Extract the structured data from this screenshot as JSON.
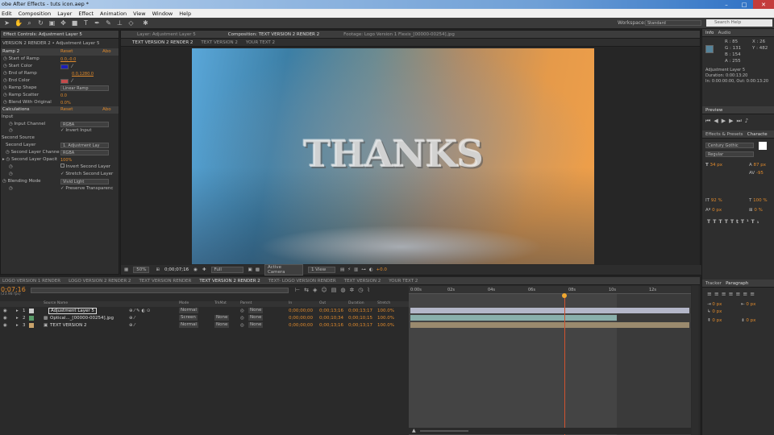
{
  "window": {
    "title": "obe After Effects - tuts icon.aep *"
  },
  "menu": [
    "Edit",
    "Composition",
    "Layer",
    "Effect",
    "Animation",
    "View",
    "Window",
    "Help"
  ],
  "toolbar": {
    "workspace_label": "Workspace:",
    "workspace_value": "Standard",
    "search_placeholder": "Search Help"
  },
  "effect_controls": {
    "tab": "Effect Controls: Adjustment Layer 5",
    "breadcrumb": "VERSION 2 RENDER 2 • Adjustment Layer 5",
    "effect_name": "Ramp 2",
    "reset": "Reset",
    "about": "Abo",
    "rows": [
      {
        "label": "Start of Ramp",
        "value": "0.0,-0.0"
      },
      {
        "label": "Start Color",
        "value": ""
      },
      {
        "label": "End of Ramp",
        "value": "0.0,1280.0"
      },
      {
        "label": "End Color",
        "value": ""
      },
      {
        "label": "Ramp Shape",
        "value": "Linear Ramp"
      },
      {
        "label": "Ramp Scatter",
        "value": "0.0"
      },
      {
        "label": "Blend With Original",
        "value": "0.0%"
      }
    ],
    "calc": {
      "name": "Calculations",
      "reset": "Reset",
      "about": "Abo"
    },
    "input_label": "Input",
    "input_channel": {
      "label": "Input Channel",
      "value": "RGBA"
    },
    "invert_input": "Invert Input",
    "second_source": "Second Source",
    "second_layer": {
      "label": "Second Layer",
      "value": "1. Adjustment Lay"
    },
    "second_layer_channel": {
      "label": "Second Layer Channe",
      "value": "RGBA"
    },
    "second_layer_opacity": {
      "label": "Second Layer Opacit",
      "value": "100%"
    },
    "invert_second": "Invert Second Layer",
    "stretch_second": "Stretch Second Layer",
    "blending_mode": {
      "label": "Blending Mode",
      "value": "Vivid Light"
    },
    "preserve_transparency": "Preserve Transparenc"
  },
  "composition": {
    "tabs": [
      "Layer: Adjustment Layer 5",
      "Composition: TEXT VERSION 2 RENDER 2",
      "Footage: Logo Version 1 Flexis_[00000-00254].jpg"
    ],
    "subtabs": [
      "TEXT VERSION 2 RENDER 2",
      "TEXT VERSION 2",
      "YOUR TEXT 2"
    ],
    "preview_text": "THANKS",
    "viewer_bar": {
      "zoom": "50%",
      "timecode": "0;00;07;16",
      "resolution": "Full",
      "camera": "Active Camera",
      "view": "1 View",
      "offset": "+0.0"
    }
  },
  "timeline": {
    "tabs": [
      "LOGO VERSION 1 RENDER",
      "LOGO VERSION 2 RENDER 2",
      "TEXT VERSION RENDER",
      "TEXT VERSION 2 RENDER 2",
      "TEXT- LOGO VERSION RENDER",
      "TEXT VERSION 2",
      "YOUR TEXT 2"
    ],
    "timecode": "0;07;16",
    "fps": "(23.98 fps)",
    "headers": {
      "source": "Source Name",
      "mode": "Mode",
      "trkmat": "TrkMat",
      "parent": "Parent",
      "in": "In",
      "out": "Out",
      "duration": "Duration",
      "stretch": "Stretch"
    },
    "layers": [
      {
        "num": "1",
        "name": "Adjustment Layer 5",
        "mode": "Normal",
        "trkmat": "",
        "parent": "None",
        "in": "0;00;00;00",
        "out": "0;00;13;16",
        "duration": "0;00;13;17",
        "stretch": "100.0%"
      },
      {
        "num": "2",
        "name": "Optical..._[00000-00254].jpg",
        "mode": "Screen",
        "trkmat": "None",
        "parent": "None",
        "in": "0;00;00;00",
        "out": "0;00;10;34",
        "duration": "0;00;10;15",
        "stretch": "100.0%"
      },
      {
        "num": "3",
        "name": "TEXT VERSION 2",
        "mode": "Normal",
        "trkmat": "None",
        "parent": "None",
        "in": "0;00;00;00",
        "out": "0;00;13;16",
        "duration": "0;00;13;17",
        "stretch": "100.0%"
      }
    ],
    "ruler": [
      "0:00s",
      "02s",
      "04s",
      "06s",
      "08s",
      "10s",
      "12s"
    ],
    "playhead_fraction": 0.55
  },
  "info": {
    "tabs": [
      "Info",
      "Audio"
    ],
    "r": "R : 85",
    "g": "G : 131",
    "b": "B : 154",
    "a": "A : 255",
    "x": "X : 26",
    "y": "Y : 482",
    "layer": "Adjustment Layer 5",
    "duration": "Duration: 0:00:13:20",
    "inout": "In: 0:00:00:00, Out: 0:00:13:20"
  },
  "preview": {
    "tab": "Preview"
  },
  "character": {
    "tabs": [
      "Effects & Presets",
      "Characte"
    ],
    "font": "Century Gothic",
    "style": "Regular",
    "size": "34 px",
    "leading": "87 px",
    "tracking": "-95",
    "vscale": "92 %",
    "hscale": "100 %",
    "baseline": "0 px",
    "tsume": "0 %"
  },
  "paragraph": {
    "tabs": [
      "Tracker",
      "Paragraph"
    ],
    "indent1": "0 px",
    "indent2": "0 px",
    "indent3": "0 px",
    "space1": "0 px",
    "space2": "0 px"
  }
}
